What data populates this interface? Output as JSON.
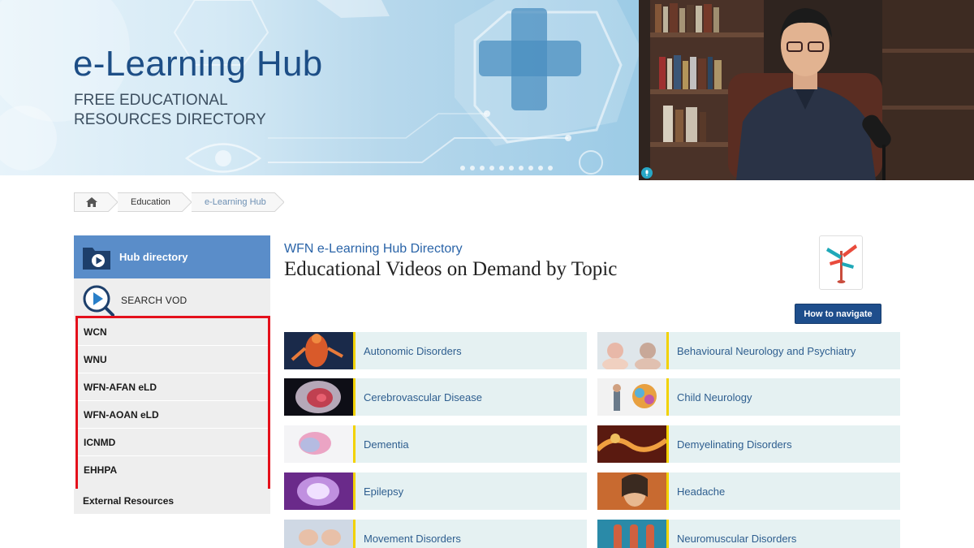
{
  "banner": {
    "title": "e-Learning Hub",
    "subtitle": "FREE EDUCATIONAL RESOURCES DIRECTORY"
  },
  "breadcrumb": {
    "home_icon": "home-icon",
    "items": [
      "Education",
      "e-Learning Hub"
    ]
  },
  "sidebar": {
    "hub_label": "Hub directory",
    "search_label": "SEARCH VOD",
    "group_items": [
      "WCN",
      "WNU",
      "WFN-AFAN eLD",
      "WFN-AOAN eLD",
      "ICNMD",
      "EHHPA"
    ],
    "external_label": "External Resources"
  },
  "main": {
    "subtitle": "WFN e-Learning Hub Directory",
    "title": "Educational Videos on Demand by Topic",
    "how_button": "How to navigate",
    "topics": [
      "Autonomic Disorders",
      "Behavioural Neurology and Psychiatry",
      "Cerebrovascular Disease",
      "Child Neurology",
      "Dementia",
      "Demyelinating Disorders",
      "Epilepsy",
      "Headache",
      "Movement Disorders",
      "Neuromuscular Disorders"
    ]
  },
  "colors": {
    "accent": "#5a8dc9",
    "button": "#1e4e8c",
    "highlight_border": "#e4101b",
    "topic_bar": "#f2d200",
    "topic_bg": "#e5f1f2"
  }
}
